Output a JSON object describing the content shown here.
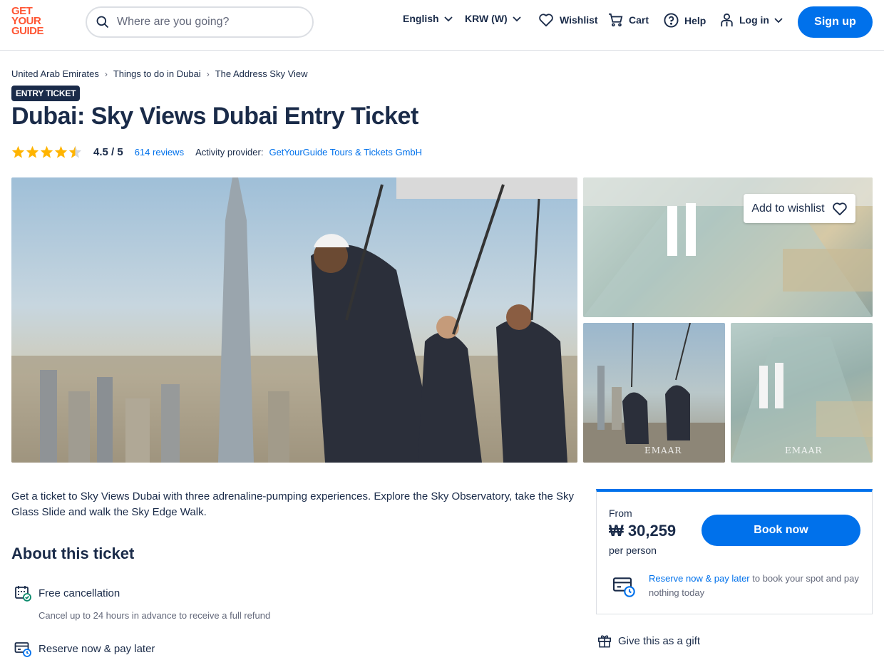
{
  "header": {
    "logo_lines": [
      "GET",
      "YOUR",
      "GUIDE"
    ],
    "search_placeholder": "Where are you going?",
    "language": "English",
    "currency": "KRW (W)",
    "wishlist": "Wishlist",
    "cart": "Cart",
    "help": "Help",
    "login": "Log in",
    "signup": "Sign up"
  },
  "breadcrumb": [
    "United Arab Emirates",
    "Things to do in Dubai",
    "The Address Sky View"
  ],
  "badge": "ENTRY TICKET",
  "title": "Dubai: Sky Views Dubai Entry Ticket",
  "rating": {
    "value": "4.5 / 5",
    "stars": 4.5,
    "reviews": "614 reviews",
    "provider_label": "Activity provider:",
    "provider": "GetYourGuide Tours & Tickets GmbH"
  },
  "gallery": {
    "wishlist_button": "Add to wishlist",
    "watermark": "EMAAR"
  },
  "description": "Get a ticket to Sky Views Dubai with three adrenaline-pumping experiences. Explore the Sky Observatory, take the Sky Glass Slide and walk the Sky Edge Walk.",
  "about": {
    "title": "About this ticket",
    "features": [
      {
        "title": "Free cancellation",
        "subtitle": "Cancel up to 24 hours in advance to receive a full refund"
      },
      {
        "title": "Reserve now & pay later"
      }
    ]
  },
  "booking": {
    "from": "From",
    "price": "₩ 30,259",
    "per_person": "per person",
    "book_button": "Book now",
    "reserve_link": "Reserve now & pay later",
    "reserve_text": " to book your spot and pay nothing today"
  },
  "gift": "Give this as a gift",
  "colors": {
    "brand_orange": "#ff5533",
    "primary_blue": "#0071eb",
    "navy_text": "#1a2b49",
    "star_yellow": "#ffb400"
  }
}
